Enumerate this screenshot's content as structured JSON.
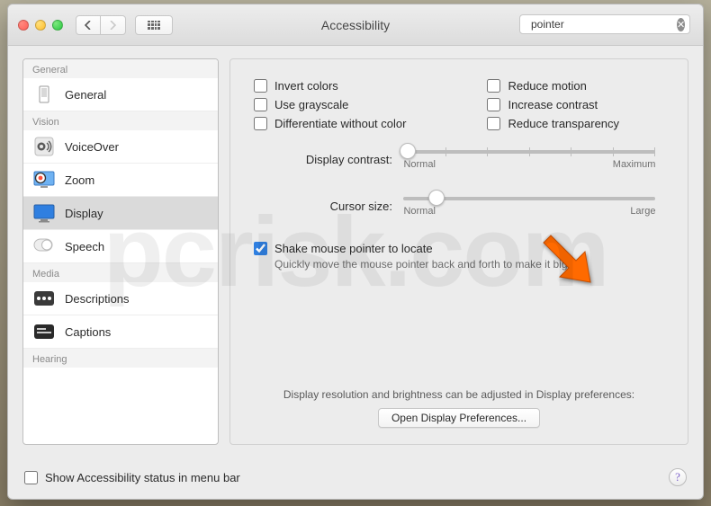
{
  "window": {
    "title": "Accessibility"
  },
  "search": {
    "value": "pointer"
  },
  "sidebar": {
    "groups": {
      "0": {
        "label": "General"
      },
      "1": {
        "label": "Vision"
      },
      "2": {
        "label": "Media"
      },
      "3": {
        "label": "Hearing"
      }
    },
    "items": {
      "general": {
        "label": "General"
      },
      "voiceover": {
        "label": "VoiceOver"
      },
      "zoom": {
        "label": "Zoom"
      },
      "display": {
        "label": "Display"
      },
      "speech": {
        "label": "Speech"
      },
      "descriptions": {
        "label": "Descriptions"
      },
      "captions": {
        "label": "Captions"
      }
    }
  },
  "options": {
    "invert": {
      "label": "Invert colors"
    },
    "grayscale": {
      "label": "Use grayscale"
    },
    "differentiate": {
      "label": "Differentiate without color"
    },
    "reduce_motion": {
      "label": "Reduce motion"
    },
    "increase_contrast": {
      "label": "Increase contrast"
    },
    "reduce_transparency": {
      "label": "Reduce transparency"
    }
  },
  "sliders": {
    "contrast": {
      "label": "Display contrast:",
      "min_label": "Normal",
      "max_label": "Maximum"
    },
    "cursor": {
      "label": "Cursor size:",
      "min_label": "Normal",
      "max_label": "Large"
    }
  },
  "shake": {
    "label": "Shake mouse pointer to locate",
    "help": "Quickly move the mouse pointer back and forth to make it bigger."
  },
  "footer": {
    "note": "Display resolution and brightness can be adjusted in Display preferences:",
    "button": "Open Display Preferences..."
  },
  "bottom": {
    "menu_label": "Show Accessibility status in menu bar"
  },
  "watermark": "pcrisk.com"
}
